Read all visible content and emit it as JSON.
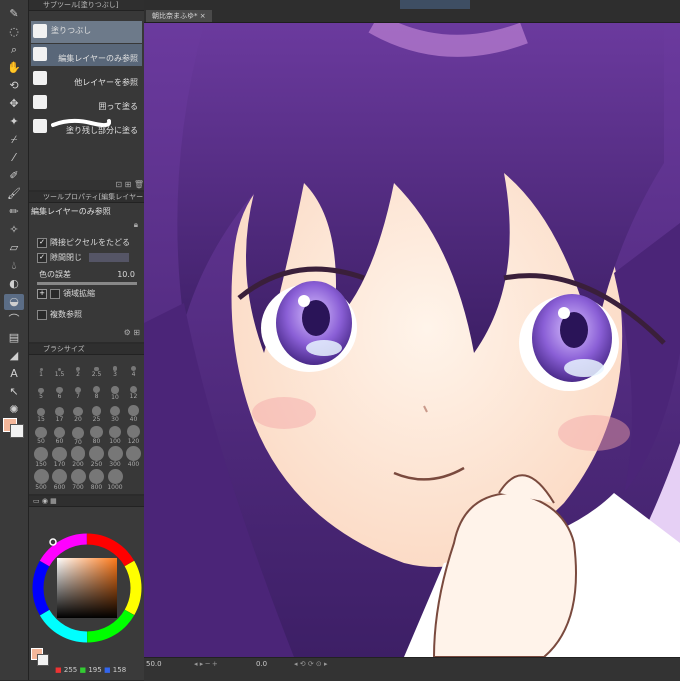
{
  "subtool": {
    "title": "サブツール[塗りつぶし]",
    "items": [
      {
        "label": "塗りつぶし"
      },
      {
        "label": "編集レイヤーのみ参照"
      },
      {
        "label": "他レイヤーを参照"
      },
      {
        "label": "囲って塗る"
      },
      {
        "label": "塗り残し部分に塗る"
      }
    ]
  },
  "toolprop": {
    "title": "ツールプロパティ[編集レイヤー",
    "heading": "編集レイヤーのみ参照",
    "rows": [
      {
        "label": "隣接ピクセルをたどる",
        "checked": true
      },
      {
        "label": "隙間閉じ",
        "checked": true
      },
      {
        "label": "色の誤差",
        "value": "10.0"
      },
      {
        "label": "領域拡縮",
        "checked": false
      },
      {
        "label": "複数参照",
        "checked": false
      }
    ]
  },
  "brushsize": {
    "title": "ブラシサイズ",
    "sizes": [
      "1",
      "1.5",
      "2",
      "2.5",
      "3",
      "4",
      "5",
      "6",
      "7",
      "8",
      "10",
      "12",
      "15",
      "17",
      "20",
      "25",
      "30",
      "40",
      "50",
      "60",
      "70",
      "80",
      "100",
      "120",
      "150",
      "170",
      "200",
      "250",
      "300",
      "400",
      "500",
      "600",
      "700",
      "800",
      "1000"
    ]
  },
  "color": {
    "r": "255",
    "g": "195",
    "b": "158",
    "main": "#f4b79a"
  },
  "canvas": {
    "tab_label": "朝比奈まふゆ*"
  },
  "status": {
    "zoom": "50.0",
    "angle": "0.0"
  }
}
